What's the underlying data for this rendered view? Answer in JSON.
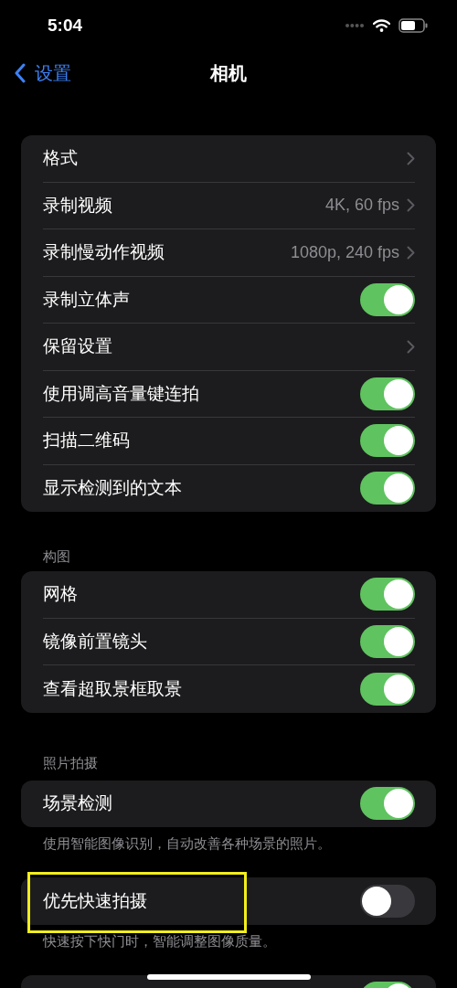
{
  "status_bar": {
    "time": "5:04"
  },
  "nav": {
    "back": "设置",
    "title": "相机"
  },
  "groups": [
    {
      "rows": [
        {
          "kind": "link",
          "label": "格式"
        },
        {
          "kind": "link",
          "label": "录制视频",
          "value": "4K, 60 fps"
        },
        {
          "kind": "link",
          "label": "录制慢动作视频",
          "value": "1080p, 240 fps"
        },
        {
          "kind": "toggle",
          "label": "录制立体声",
          "on": true
        },
        {
          "kind": "link",
          "label": "保留设置"
        },
        {
          "kind": "toggle",
          "label": "使用调高音量键连拍",
          "on": true
        },
        {
          "kind": "toggle",
          "label": "扫描二维码",
          "on": true
        },
        {
          "kind": "toggle",
          "label": "显示检测到的文本",
          "on": true
        }
      ]
    },
    {
      "header": "构图",
      "rows": [
        {
          "kind": "toggle",
          "label": "网格",
          "on": true
        },
        {
          "kind": "toggle",
          "label": "镜像前置镜头",
          "on": true
        },
        {
          "kind": "toggle",
          "label": "查看超取景框取景",
          "on": true
        }
      ]
    },
    {
      "header": "照片拍摄",
      "rows": [
        {
          "kind": "toggle",
          "label": "场景检测",
          "on": true
        }
      ],
      "footer": "使用智能图像识别，自动改善各种场景的照片。"
    },
    {
      "highlighted": true,
      "rows": [
        {
          "kind": "toggle",
          "label": "优先快速拍摄",
          "on": false
        }
      ],
      "footer": "快速按下快门时，智能调整图像质量。"
    },
    {
      "rows": [
        {
          "kind": "toggle",
          "on": true
        }
      ]
    }
  ]
}
